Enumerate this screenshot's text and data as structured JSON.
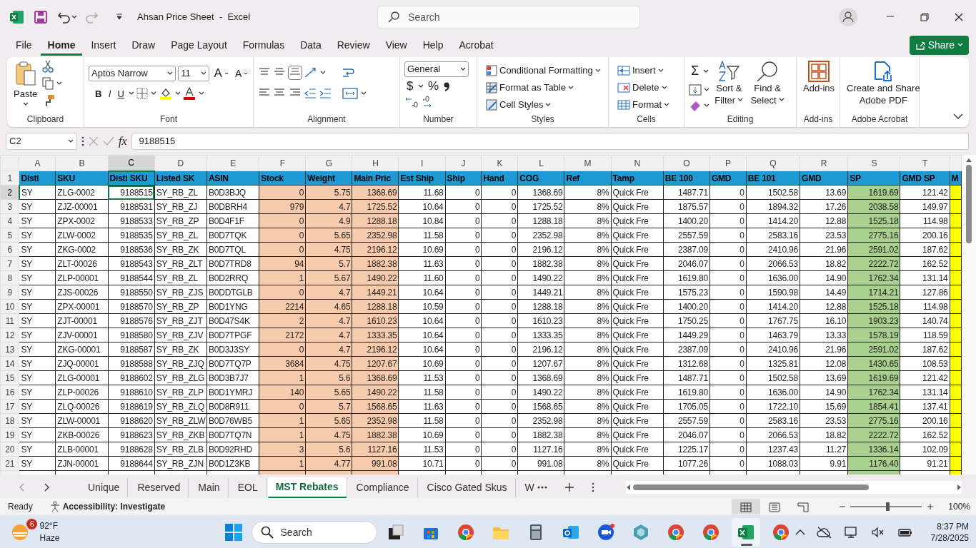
{
  "window": {
    "title": "Ahsan Price Sheet  -  Excel",
    "search_placeholder": "Search"
  },
  "ribbon_tabs": [
    {
      "label": "File",
      "selected": false
    },
    {
      "label": "Home",
      "selected": true
    },
    {
      "label": "Insert",
      "selected": false
    },
    {
      "label": "Draw",
      "selected": false
    },
    {
      "label": "Page Layout",
      "selected": false
    },
    {
      "label": "Formulas",
      "selected": false
    },
    {
      "label": "Data",
      "selected": false
    },
    {
      "label": "Review",
      "selected": false
    },
    {
      "label": "View",
      "selected": false
    },
    {
      "label": "Help",
      "selected": false
    },
    {
      "label": "Acrobat",
      "selected": false
    }
  ],
  "share": "Share",
  "ribbon": {
    "clipboard": {
      "paste": "Paste",
      "label": "Clipboard"
    },
    "font": {
      "name": "Aptos Narrow",
      "size": "11",
      "size_buttons": [
        {
          "kind": "grow",
          "label": "A"
        },
        {
          "kind": "shrink",
          "label": "A"
        }
      ],
      "styles": [
        {
          "kind": "bold",
          "label": "B"
        },
        {
          "kind": "italic",
          "label": "I"
        },
        {
          "kind": "underline",
          "label": "U"
        }
      ],
      "label": "Font"
    },
    "alignment": {
      "label": "Alignment"
    },
    "number": {
      "format": "General",
      "symbols": [
        "$",
        "%"
      ],
      "label": "Number"
    },
    "styles": {
      "items": [
        "Conditional Formatting",
        "Format as Table",
        "Cell Styles"
      ],
      "label": "Styles"
    },
    "cells": {
      "items": [
        "Insert",
        "Delete",
        "Format"
      ],
      "label": "Cells"
    },
    "editing": {
      "sum": "Σ",
      "sort_filter": [
        "Sort &",
        "Filter"
      ],
      "find_select": [
        "Find &",
        "Select"
      ],
      "label": "Editing"
    },
    "addins": {
      "button": "Add-ins",
      "label": "Add-ins"
    },
    "acrobat": {
      "button": [
        "Create and Share",
        "Adobe PDF"
      ],
      "label": "Adobe Acrobat"
    }
  },
  "formula_bar": {
    "name_box": "C2",
    "function_label": "fx",
    "value": "9188515"
  },
  "columns": [
    {
      "letter": "A",
      "header": "Disti",
      "kind": "text",
      "selected": false
    },
    {
      "letter": "B",
      "header": "SKU",
      "kind": "text",
      "selected": false
    },
    {
      "letter": "C",
      "header": "Disti SKU",
      "kind": "number",
      "selected": true
    },
    {
      "letter": "D",
      "header": "Listed SK",
      "kind": "text",
      "selected": false
    },
    {
      "letter": "E",
      "header": "ASIN",
      "kind": "text",
      "selected": false
    },
    {
      "letter": "F",
      "header": "Stock",
      "kind": "number",
      "selected": false,
      "color": "#f8cbad"
    },
    {
      "letter": "G",
      "header": "Weight",
      "kind": "number",
      "selected": false,
      "color": "#f8cbad"
    },
    {
      "letter": "H",
      "header": "Main Pric",
      "kind": "number",
      "selected": false,
      "color": "#f8cbad"
    },
    {
      "letter": "I",
      "header": "Est Ship",
      "kind": "number",
      "selected": false
    },
    {
      "letter": "J",
      "header": "Ship",
      "kind": "number",
      "selected": false
    },
    {
      "letter": "K",
      "header": "Hand",
      "kind": "number",
      "selected": false
    },
    {
      "letter": "L",
      "header": "COG",
      "kind": "number",
      "selected": false
    },
    {
      "letter": "M",
      "header": "Ref",
      "kind": "number",
      "selected": false
    },
    {
      "letter": "N",
      "header": "Tamp",
      "kind": "text",
      "selected": false
    },
    {
      "letter": "O",
      "header": "BE 100",
      "kind": "number",
      "selected": false
    },
    {
      "letter": "P",
      "header": "GMD",
      "kind": "number",
      "selected": false
    },
    {
      "letter": "Q",
      "header": "BE 101",
      "kind": "number",
      "selected": false
    },
    {
      "letter": "R",
      "header": "GMD",
      "kind": "number",
      "selected": false
    },
    {
      "letter": "S",
      "header": "SP",
      "kind": "number",
      "selected": false,
      "color": "#a9d08e"
    },
    {
      "letter": "T",
      "header": "GMD SP",
      "kind": "number",
      "selected": false
    },
    {
      "header": "M",
      "kind": "text",
      "selected": false,
      "color": "#ffff00"
    }
  ],
  "header_row_number": "1",
  "rows": [
    {
      "number": "2",
      "selected": true,
      "cells": [
        "SY",
        "ZLG-0002",
        "9188515",
        "SY_RB_ZL",
        "B0D3BJQ",
        "0",
        "5.75",
        "1368.69",
        "11.68",
        "0",
        "0",
        "1368.69",
        "8%",
        "Quick Fre",
        "1487.71",
        "0",
        "1502.58",
        "13.69",
        "1619.69",
        "121.42"
      ]
    },
    {
      "number": "3",
      "selected": false,
      "cells": [
        "SY",
        "ZJZ-00001",
        "9188531",
        "SY_RB_ZJ",
        "B0DBRH4",
        "979",
        "4.7",
        "1725.52",
        "10.64",
        "0",
        "0",
        "1725.52",
        "8%",
        "Quick Fre",
        "1875.57",
        "0",
        "1894.32",
        "17.26",
        "2038.58",
        "149.97"
      ]
    },
    {
      "number": "4",
      "selected": false,
      "cells": [
        "SY",
        "ZPX-0002",
        "9188533",
        "SY_RB_ZP",
        "B0D4F1F",
        "0",
        "4.9",
        "1288.18",
        "10.84",
        "0",
        "0",
        "1288.18",
        "8%",
        "Quick Fre",
        "1400.20",
        "0",
        "1414.20",
        "12.88",
        "1525.18",
        "114.98"
      ]
    },
    {
      "number": "5",
      "selected": false,
      "cells": [
        "SY",
        "ZLW-0002",
        "9188535",
        "SY_RB_ZL",
        "B0D7TQK",
        "0",
        "5.65",
        "2352.98",
        "11.58",
        "0",
        "0",
        "2352.98",
        "8%",
        "Quick Fre",
        "2557.59",
        "0",
        "2583.16",
        "23.53",
        "2775.16",
        "200.16"
      ]
    },
    {
      "number": "6",
      "selected": false,
      "cells": [
        "SY",
        "ZKG-0002",
        "9188536",
        "SY_RB_ZK",
        "B0D7TQL",
        "0",
        "4.75",
        "2196.12",
        "10.69",
        "0",
        "0",
        "2196.12",
        "8%",
        "Quick Fre",
        "2387.09",
        "0",
        "2410.96",
        "21.96",
        "2591.02",
        "187.62"
      ]
    },
    {
      "number": "7",
      "selected": false,
      "cells": [
        "SY",
        "ZLT-00026",
        "9188543",
        "SY_RB_ZLT",
        "B0D7TRD8",
        "94",
        "5.7",
        "1882.38",
        "11.63",
        "0",
        "0",
        "1882.38",
        "8%",
        "Quick Fre",
        "2046.07",
        "0",
        "2066.53",
        "18.82",
        "2222.72",
        "162.52"
      ]
    },
    {
      "number": "8",
      "selected": false,
      "cells": [
        "SY",
        "ZLP-00001",
        "9188544",
        "SY_RB_ZL",
        "B0D2RRQ",
        "1",
        "5.67",
        "1490.22",
        "11.60",
        "0",
        "0",
        "1490.22",
        "8%",
        "Quick Fre",
        "1619.80",
        "0",
        "1636.00",
        "14.90",
        "1762.34",
        "131.14"
      ]
    },
    {
      "number": "9",
      "selected": false,
      "cells": [
        "SY",
        "ZJS-00026",
        "9188550",
        "SY_RB_ZJS",
        "B0DDTGLB",
        "0",
        "4.7",
        "1449.21",
        "10.64",
        "0",
        "0",
        "1449.21",
        "8%",
        "Quick Fre",
        "1575.23",
        "0",
        "1590.98",
        "14.49",
        "1714.21",
        "127.86"
      ]
    },
    {
      "number": "10",
      "selected": false,
      "cells": [
        "SY",
        "ZPX-00001",
        "9188570",
        "SY_RB_ZP",
        "B0D1YNG",
        "2214",
        "4.65",
        "1288.18",
        "10.59",
        "0",
        "0",
        "1288.18",
        "8%",
        "Quick Fre",
        "1400.20",
        "0",
        "1414.20",
        "12.88",
        "1525.18",
        "114.98"
      ]
    },
    {
      "number": "11",
      "selected": false,
      "cells": [
        "SY",
        "ZJT-00001",
        "9188576",
        "SY_RB_ZJT",
        "B0D47S4K",
        "2",
        "4.7",
        "1610.23",
        "10.64",
        "0",
        "0",
        "1610.23",
        "8%",
        "Quick Fre",
        "1750.25",
        "0",
        "1767.75",
        "16.10",
        "1903.23",
        "140.74"
      ]
    },
    {
      "number": "12",
      "selected": false,
      "cells": [
        "SY",
        "ZJV-00001",
        "9188580",
        "SY_RB_ZJV",
        "B0D7TPGF",
        "2172",
        "4.7",
        "1333.35",
        "10.64",
        "0",
        "0",
        "1333.35",
        "8%",
        "Quick Fre",
        "1449.29",
        "0",
        "1463.79",
        "13.33",
        "1578.19",
        "118.59"
      ]
    },
    {
      "number": "13",
      "selected": false,
      "cells": [
        "SY",
        "ZKG-00001",
        "9188587",
        "SY_RB_ZK",
        "B0D3J3SY",
        "0",
        "4.7",
        "2196.12",
        "10.64",
        "0",
        "0",
        "2196.12",
        "8%",
        "Quick Fre",
        "2387.09",
        "0",
        "2410.96",
        "21.96",
        "2591.02",
        "187.62"
      ]
    },
    {
      "number": "14",
      "selected": false,
      "cells": [
        "SY",
        "ZJQ-00001",
        "9188588",
        "SY_RB_ZJQ",
        "B0D7TQ7P",
        "3684",
        "4.75",
        "1207.67",
        "10.69",
        "0",
        "0",
        "1207.67",
        "8%",
        "Quick Fre",
        "1312.68",
        "0",
        "1325.81",
        "12.08",
        "1430.65",
        "108.53"
      ]
    },
    {
      "number": "15",
      "selected": false,
      "cells": [
        "SY",
        "ZLG-00001",
        "9188602",
        "SY_RB_ZLG",
        "B0D3B7J7",
        "1",
        "5.6",
        "1368.69",
        "11.53",
        "0",
        "0",
        "1368.69",
        "8%",
        "Quick Fre",
        "1487.71",
        "0",
        "1502.58",
        "13.69",
        "1619.69",
        "121.42"
      ]
    },
    {
      "number": "16",
      "selected": false,
      "cells": [
        "SY",
        "ZLP-00026",
        "9188610",
        "SY_RB_ZLP",
        "B0D1YMRJ",
        "140",
        "5.65",
        "1490.22",
        "11.58",
        "0",
        "0",
        "1490.22",
        "8%",
        "Quick Fre",
        "1619.80",
        "0",
        "1636.00",
        "14.90",
        "1762.34",
        "131.14"
      ]
    },
    {
      "number": "17",
      "selected": false,
      "cells": [
        "SY",
        "ZLQ-00026",
        "9188619",
        "SY_RB_ZLQ",
        "B0D8R911",
        "0",
        "5.7",
        "1568.65",
        "11.63",
        "0",
        "0",
        "1568.65",
        "8%",
        "Quick Fre",
        "1705.05",
        "0",
        "1722.10",
        "15.69",
        "1854.41",
        "137.41"
      ]
    },
    {
      "number": "18",
      "selected": false,
      "cells": [
        "SY",
        "ZLW-00001",
        "9188620",
        "SY_RB_ZLW",
        "B0D76WB5",
        "1",
        "5.65",
        "2352.98",
        "11.58",
        "0",
        "0",
        "2352.98",
        "8%",
        "Quick Fre",
        "2557.59",
        "0",
        "2583.16",
        "23.53",
        "2775.16",
        "200.16"
      ]
    },
    {
      "number": "19",
      "selected": false,
      "cells": [
        "SY",
        "ZKB-00026",
        "9188623",
        "SY_RB_ZKB",
        "B0D7TQ7N",
        "1",
        "4.75",
        "1882.38",
        "10.69",
        "0",
        "0",
        "1882.38",
        "8%",
        "Quick Fre",
        "2046.07",
        "0",
        "2066.53",
        "18.82",
        "2222.72",
        "162.52"
      ]
    },
    {
      "number": "20",
      "selected": false,
      "cells": [
        "SY",
        "ZLB-00001",
        "9188628",
        "SY_RB_ZLB",
        "B0D92RHD",
        "3",
        "5.6",
        "1127.16",
        "11.53",
        "0",
        "0",
        "1127.16",
        "8%",
        "Quick Fre",
        "1225.17",
        "0",
        "1237.43",
        "11.27",
        "1336.14",
        "102.09"
      ]
    },
    {
      "number": "21",
      "selected": false,
      "cells": [
        "SY",
        "ZJN-00001",
        "9188644",
        "SY_RB_ZJN",
        "B0D1Z3KB",
        "1",
        "4.77",
        "991.08",
        "10.71",
        "0",
        "0",
        "991.08",
        "8%",
        "Quick Fre",
        "1077.26",
        "0",
        "1088.03",
        "9.91",
        "1176.40",
        "91.21"
      ]
    }
  ],
  "sheet_tabs": [
    {
      "label": "Unique",
      "selected": false
    },
    {
      "label": "Reserved",
      "selected": false
    },
    {
      "label": "Main",
      "selected": false
    },
    {
      "label": "EOL",
      "selected": false
    },
    {
      "label": "MST Rebates",
      "selected": true
    },
    {
      "label": "Compliance",
      "selected": false
    },
    {
      "label": "Cisco Gated Skus",
      "selected": false
    },
    {
      "label": "W",
      "selected": false
    }
  ],
  "status_bar": {
    "ready": "Ready",
    "accessibility": "Accessibility: Investigate",
    "views": [
      {
        "kind": "normal",
        "selected": true
      },
      {
        "kind": "page-layout",
        "selected": false
      },
      {
        "kind": "page-break",
        "selected": false
      }
    ],
    "zoom": {
      "level": 0.52,
      "reading": "100%"
    }
  },
  "taskbar": {
    "weather": {
      "badge": "6",
      "temperature": "92°F",
      "condition": "Haze"
    },
    "search_placeholder": "Search",
    "apps": [
      {
        "kind": "taskview",
        "selected": false
      },
      {
        "kind": "store",
        "selected": false
      },
      {
        "kind": "chrome",
        "selected": false
      },
      {
        "kind": "folder",
        "selected": false
      },
      {
        "kind": "calculator",
        "selected": false
      },
      {
        "kind": "outlook",
        "selected": false
      },
      {
        "kind": "zoom",
        "selected": false
      },
      {
        "kind": "gem",
        "selected": false
      },
      {
        "kind": "chrome",
        "selected": false
      },
      {
        "kind": "chrome",
        "selected": false
      },
      {
        "kind": "excel",
        "selected": true
      },
      {
        "kind": "chrome",
        "selected": false
      }
    ],
    "time": "8:37 PM",
    "date": "7/28/2025"
  }
}
